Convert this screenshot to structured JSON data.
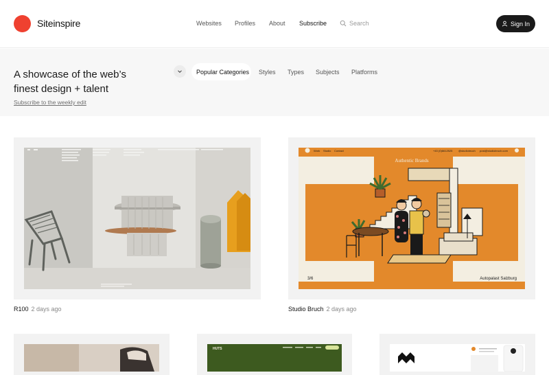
{
  "brand": {
    "name": "Siteinspire",
    "logo_color": "#ef4130"
  },
  "nav": {
    "items": [
      "Websites",
      "Profiles",
      "About",
      "Subscribe"
    ],
    "active": "Subscribe"
  },
  "search": {
    "placeholder": "Search"
  },
  "signin": {
    "label": "Sign In"
  },
  "hero": {
    "title": "A showcase of the web’s finest design + talent",
    "link": "Subscribe to the weekly edit"
  },
  "categories": {
    "items": [
      "Popular Categories",
      "Styles",
      "Types",
      "Subjects",
      "Platforms"
    ],
    "active": "Popular Categories"
  },
  "cards": [
    {
      "name": "R100",
      "ago": "2 days ago"
    },
    {
      "name": "Studio Bruch",
      "ago": "2 days ago"
    }
  ],
  "shot2": {
    "nav_links": [
      "Work",
      "Studio",
      "Contact"
    ],
    "phone": "+43 (0)6612525",
    "handle": "@studiobruch",
    "email": "post@studiobruch.com",
    "headline": "Authentic Brands",
    "counter": "3/6",
    "client": "Autopalast Salzburg"
  },
  "shot4": {
    "brand": "HUTS"
  },
  "colors": {
    "accent": "#ef4130",
    "bruch_orange": "#e3892b",
    "huts_green": "#3d5a1f"
  }
}
